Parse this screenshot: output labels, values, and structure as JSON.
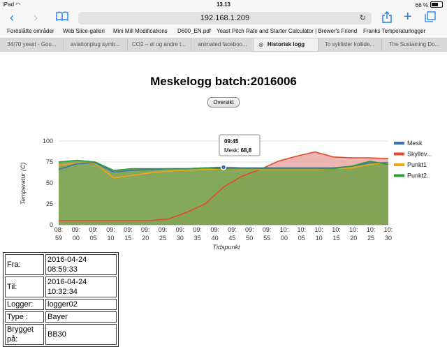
{
  "status_bar": {
    "device": "iPad",
    "wifi_icon": "wifi-icon",
    "time": "13.13",
    "battery": "66 %",
    "battery_level": 0.66
  },
  "toolbar": {
    "url": "192.168.1.209"
  },
  "bookmarks": [
    "Foreslåtte områder",
    "Web Slice-galleri",
    "Mini Mill Modifications",
    "D600_EN.pdf",
    "Yeast Pitch Rate and Starter Calculator | Brewer's Friend",
    "Franks Temperaturlogger"
  ],
  "tabs": [
    {
      "label": "34/70 yeast - Goo..."
    },
    {
      "label": "aviationplug symb..."
    },
    {
      "label": "CO2 – øl og andre t..."
    },
    {
      "label": "animated faceboo..."
    },
    {
      "label": "Historisk logg",
      "active": true
    },
    {
      "label": "To syklister kollide..."
    },
    {
      "label": "The Sustaining Do..."
    }
  ],
  "page": {
    "title": "Meskelogg batch:2016006",
    "overview_button": "Oversikt"
  },
  "tooltip": {
    "time": "09:45",
    "series": "Mesk:",
    "value": "68,8"
  },
  "chart_data": {
    "type": "area",
    "x": [
      "08:59",
      "09:05",
      "09:10",
      "09:15",
      "09:20",
      "09:25",
      "09:30",
      "09:35",
      "09:40",
      "09:45",
      "09:50",
      "09:55",
      "10:00",
      "10:05",
      "10:10",
      "10:15",
      "10:20",
      "10:25",
      "10:30"
    ],
    "x_ticks": [
      [
        "08:",
        "59"
      ],
      [
        "09:",
        "00"
      ],
      [
        "09:",
        "05"
      ],
      [
        "09:",
        "10"
      ],
      [
        "09:",
        "15"
      ],
      [
        "09:",
        "20"
      ],
      [
        "09:",
        "25"
      ],
      [
        "09:",
        "30"
      ],
      [
        "09:",
        "35"
      ],
      [
        "09:",
        "40"
      ],
      [
        "09:",
        "45"
      ],
      [
        "09:",
        "50"
      ],
      [
        "09:",
        "55"
      ],
      [
        "10:",
        "00"
      ],
      [
        "10:",
        "05"
      ],
      [
        "10:",
        "10"
      ],
      [
        "10:",
        "15"
      ],
      [
        "10:",
        "20"
      ],
      [
        "10:",
        "25"
      ],
      [
        "10:",
        "30"
      ]
    ],
    "xlabel": "Tidspunkt",
    "ylabel": "Temperatur (C)",
    "ylim": [
      0,
      100
    ],
    "yticks": [
      0,
      25,
      50,
      75,
      100
    ],
    "grid": true,
    "legend": "right",
    "series": [
      {
        "name": "Mesk",
        "color": "#3d6fb3",
        "values": [
          66,
          73,
          74,
          63,
          65,
          66,
          67,
          67,
          68,
          68.8,
          68,
          68,
          68,
          68,
          68,
          68,
          70,
          74,
          74
        ]
      },
      {
        "name": "Skyllev...",
        "color": "#e04a2a",
        "fill": "#e89d98",
        "values": [
          5,
          5,
          5,
          5,
          5,
          5,
          7,
          15,
          25,
          45,
          58,
          66,
          76,
          82,
          87,
          81,
          80,
          80,
          79
        ]
      },
      {
        "name": "Punkt1",
        "color": "#f2a51a",
        "values": [
          71,
          74,
          73,
          56,
          59,
          62,
          64,
          65,
          66,
          67,
          66,
          66,
          66,
          66,
          66,
          67,
          68,
          72,
          74
        ]
      },
      {
        "name": "Punkt2.",
        "color": "#2e9e3a",
        "fill": "#79a24f",
        "values": [
          75,
          77,
          75,
          65,
          67,
          67,
          67,
          67,
          68,
          67,
          67,
          67,
          67,
          67,
          67,
          67,
          70,
          76,
          72
        ]
      }
    ]
  },
  "info": [
    {
      "label": "Fra:",
      "value": "2016-04-24 08:59:33"
    },
    {
      "label": "Til:",
      "value": "2016-04-24 10:32:34"
    },
    {
      "label": "Logger:",
      "value": "logger02"
    },
    {
      "label": "Type :",
      "value": "Bayer"
    },
    {
      "label": "Brygget på:",
      "value": "BB30"
    }
  ]
}
